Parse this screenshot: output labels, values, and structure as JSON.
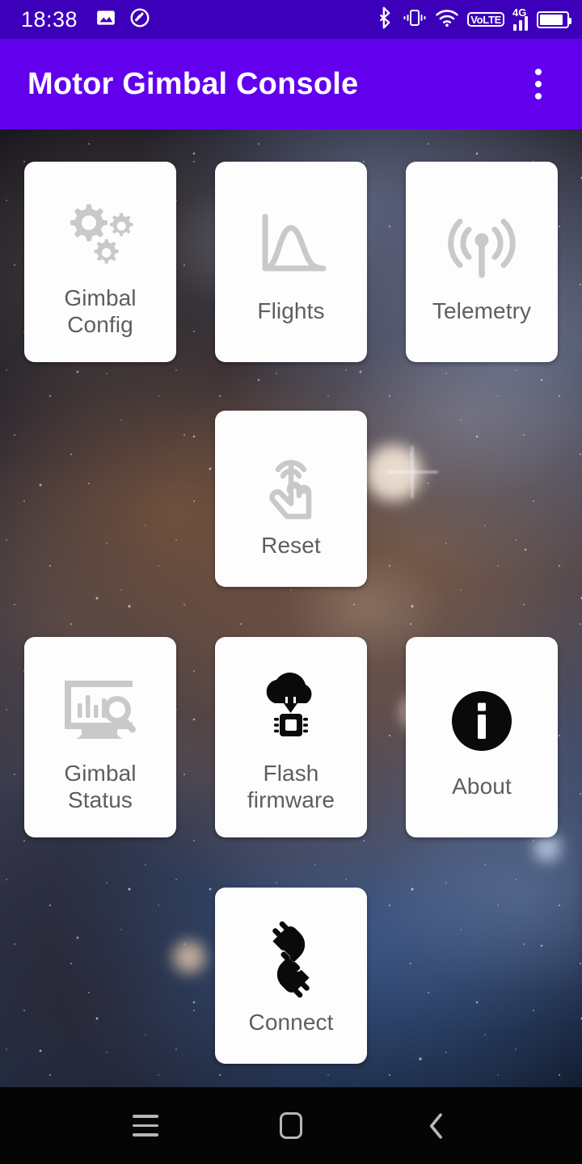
{
  "status_bar": {
    "time": "18:38",
    "left_icons": [
      "image-icon",
      "do-not-disturb-icon"
    ],
    "right_icons": [
      "bluetooth-icon",
      "vibrate-icon",
      "wifi-icon",
      "volte-icon",
      "4g-signal-icon",
      "battery-icon"
    ],
    "volte_label": "VoLTE",
    "network_label": "4G",
    "background_color": "#3d00ba",
    "foreground_color": "#ffffff"
  },
  "app_bar": {
    "title": "Motor Gimbal Console",
    "overflow_menu_name": "more-options",
    "background_color": "#6200ee",
    "title_color": "#ffffff"
  },
  "wallpaper": {
    "description": "nebula starfield",
    "dominant_colors": [
      "#2b2833",
      "#3a3b4c",
      "#22304a",
      "#7e5c46"
    ]
  },
  "grid": {
    "card_background": "#fdfdfd",
    "label_color": "#5e5e5e",
    "gray_icon_color": "#c9c9c9",
    "black_icon_color": "#0a0a0a",
    "rows": [
      {
        "cards": [
          {
            "label": "Gimbal\nConfig",
            "label_line1": "Gimbal",
            "label_line2": "Config",
            "icon": "gears-icon",
            "icon_color": "#c9c9c9"
          },
          {
            "label": "Flights",
            "icon": "flight-curve-chart-icon",
            "icon_color": "#c9c9c9"
          },
          {
            "label": "Telemetry",
            "icon": "antenna-broadcast-icon",
            "icon_color": "#c9c9c9"
          }
        ]
      },
      {
        "cards": [
          {
            "label": "Reset",
            "icon": "tap-gesture-icon",
            "icon_color": "#c9c9c9"
          }
        ]
      },
      {
        "cards": [
          {
            "label_line1": "Gimbal",
            "label_line2": "Status",
            "label": "Gimbal\nStatus",
            "icon": "monitor-chart-search-icon",
            "icon_color": "#c9c9c9"
          },
          {
            "label_line1": "Flash",
            "label_line2": "firmware",
            "label": "Flash\nfirmware",
            "icon": "cloud-download-chip-icon",
            "icon_color": "#0a0a0a"
          },
          {
            "label": "About",
            "icon": "info-circle-icon",
            "icon_color": "#0a0a0a"
          }
        ]
      },
      {
        "cards": [
          {
            "label": "Connect",
            "icon": "plug-connect-icon",
            "icon_color": "#0a0a0a"
          }
        ]
      }
    ]
  },
  "nav_bar": {
    "background_color": "#050505",
    "icon_color": "#b7b7b7",
    "buttons": [
      {
        "name": "recents-icon",
        "label": "Recents"
      },
      {
        "name": "home-icon",
        "label": "Home"
      },
      {
        "name": "back-icon",
        "label": "Back"
      }
    ]
  }
}
